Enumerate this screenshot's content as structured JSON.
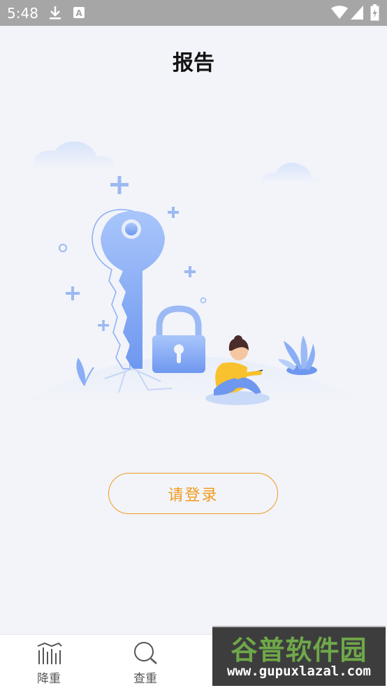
{
  "status_bar": {
    "time": "5:48",
    "icons": [
      "download-icon",
      "a-notification-icon",
      "wifi-icon",
      "signal-icon",
      "battery-icon"
    ]
  },
  "header": {
    "title": "报告"
  },
  "main": {
    "login_button": "请登录"
  },
  "tabbar": {
    "tabs": [
      {
        "label": "降重",
        "icon": "chart-bars-icon"
      },
      {
        "label": "查重",
        "icon": "search-icon"
      }
    ]
  },
  "watermark": {
    "title": "谷普软件园",
    "url": "www.gupuxlazal.com"
  },
  "colors": {
    "accent": "#f29a1e",
    "background": "#f2f4f9",
    "statusbar": "#a6a6a6",
    "illustration_blue": "#8aaef5"
  }
}
